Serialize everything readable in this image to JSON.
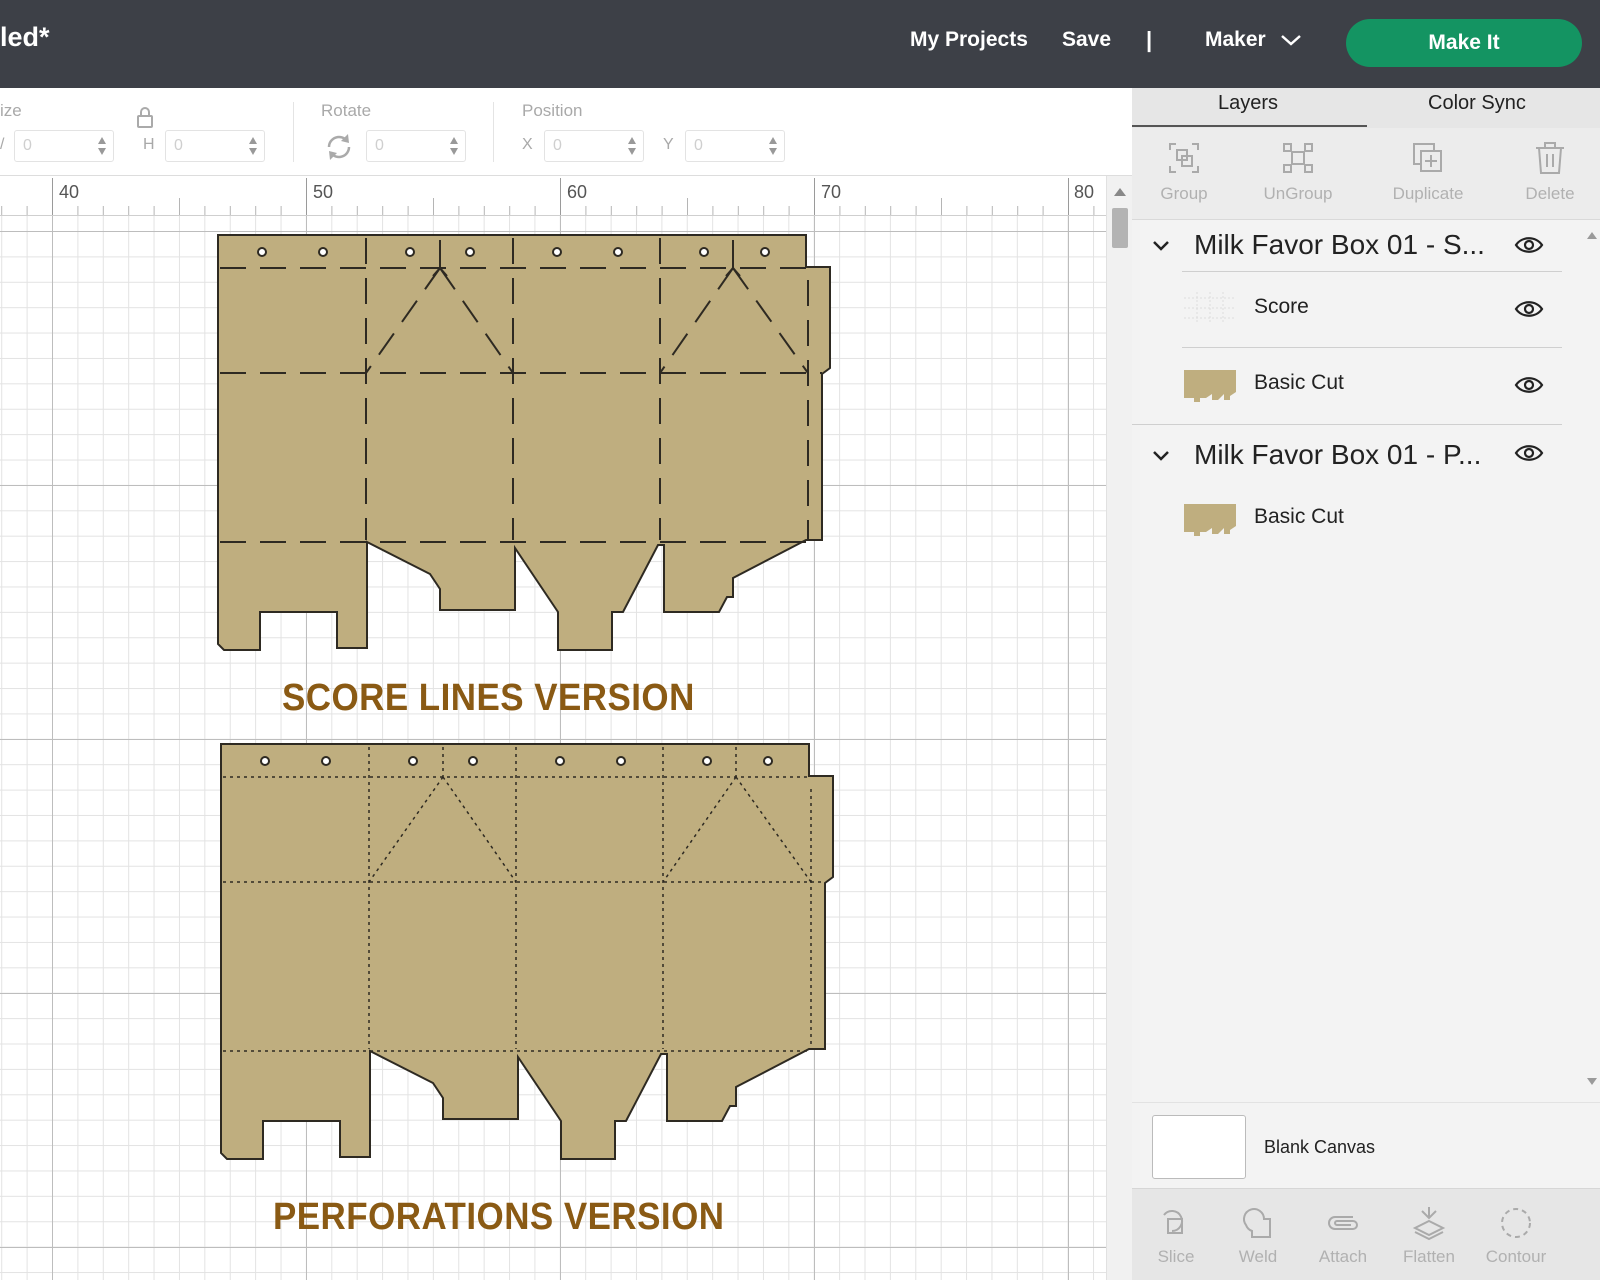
{
  "header": {
    "doc_title": "led*",
    "my_projects": "My Projects",
    "save": "Save",
    "separator": "|",
    "machine": "Maker",
    "make_it": "Make It"
  },
  "toolbar": {
    "size_label": "ize",
    "w_letter": "/",
    "w_value": "0",
    "h_letter": "H",
    "h_value": "0",
    "rotate_label": "Rotate",
    "rotate_value": "0",
    "position_label": "Position",
    "x_letter": "X",
    "x_value": "0",
    "y_letter": "Y",
    "y_value": "0"
  },
  "ruler": {
    "ticks": [
      "40",
      "50",
      "60",
      "70",
      "80"
    ]
  },
  "canvas": {
    "score_label": "SCORE LINES VERSION",
    "perf_label": "PERFORATIONS VERSION",
    "box_color": "#bfae7f",
    "label_color": "#8a5a14"
  },
  "panel": {
    "tabs": [
      "Layers",
      "Color Sync"
    ],
    "actions": [
      "Group",
      "UnGroup",
      "Duplicate",
      "Delete"
    ],
    "layers": {
      "group1": {
        "name": "Milk Favor Box 01 - S...",
        "children": [
          "Score",
          "Basic Cut"
        ]
      },
      "group2": {
        "name": "Milk Favor Box 01 - P...",
        "children": [
          "Basic Cut"
        ]
      }
    },
    "blank_canvas": "Blank Canvas",
    "bottom_tools": [
      "Slice",
      "Weld",
      "Attach",
      "Flatten",
      "Contour"
    ]
  },
  "colors": {
    "header_bg": "#3d4047",
    "accent": "#149462"
  }
}
